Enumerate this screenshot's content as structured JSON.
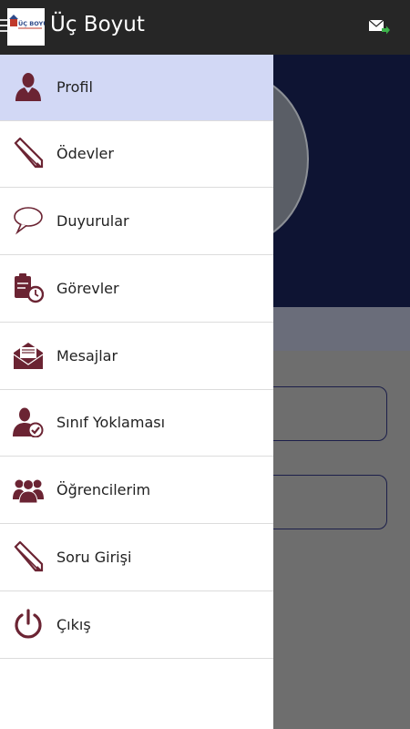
{
  "app": {
    "title": "Üç Boyut",
    "logo_text": "ÜÇ BOYUT"
  },
  "colors": {
    "accent": "#6b2433",
    "active_bg": "#d2d8f5",
    "topbar": "#262626"
  },
  "menu": [
    {
      "label": "Profil",
      "icon": "person-icon",
      "active": true
    },
    {
      "label": "Ödevler",
      "icon": "pencil-icon",
      "active": false
    },
    {
      "label": "Duyurular",
      "icon": "speech-bubble-icon",
      "active": false
    },
    {
      "label": "Görevler",
      "icon": "clipboard-clock-icon",
      "active": false
    },
    {
      "label": "Mesajlar",
      "icon": "envelope-icon",
      "active": false
    },
    {
      "label": "Sınıf Yoklaması",
      "icon": "user-check-icon",
      "active": false
    },
    {
      "label": "Öğrencilerim",
      "icon": "group-icon",
      "active": false
    },
    {
      "label": "Soru Girişi",
      "icon": "pencil-icon",
      "active": false
    },
    {
      "label": "Çıkış",
      "icon": "power-icon",
      "active": false
    }
  ]
}
